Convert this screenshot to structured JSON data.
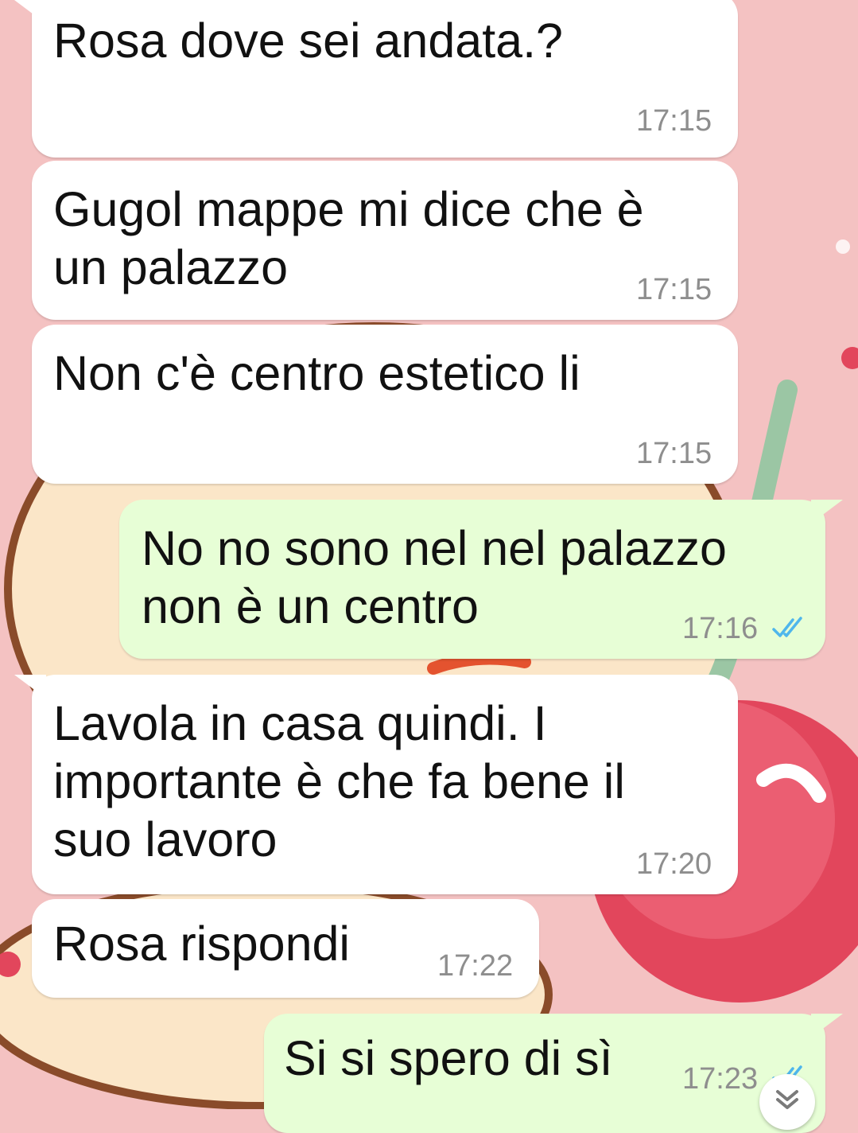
{
  "colors": {
    "wallpaper": "#f4c2c2",
    "incoming_bubble": "#ffffff",
    "outgoing_bubble": "#e7fed6",
    "read_ticks": "#4fb6ec"
  },
  "messages": [
    {
      "direction": "in",
      "text": "Rosa dove sei andata.?",
      "time": "17:15"
    },
    {
      "direction": "in",
      "text": "Gugol mappe mi dice che è\nun palazzo",
      "time": "17:15"
    },
    {
      "direction": "in",
      "text": "Non c'è centro estetico li",
      "time": "17:15"
    },
    {
      "direction": "out",
      "text": "No no sono nel nel palazzo\nnon è un centro",
      "time": "17:16",
      "status": "read"
    },
    {
      "direction": "in",
      "text": "Lavola in casa quindi. I\nimportante è che fa bene il\nsuo lavoro",
      "time": "17:20"
    },
    {
      "direction": "in",
      "text": "Rosa rispondi",
      "time": "17:22"
    },
    {
      "direction": "out",
      "text": "Si si spero di sì",
      "time": "17:23",
      "status": "read"
    }
  ],
  "icons": {
    "read_status": "double-check-icon",
    "scroll_down": "double-chevron-down-icon"
  }
}
